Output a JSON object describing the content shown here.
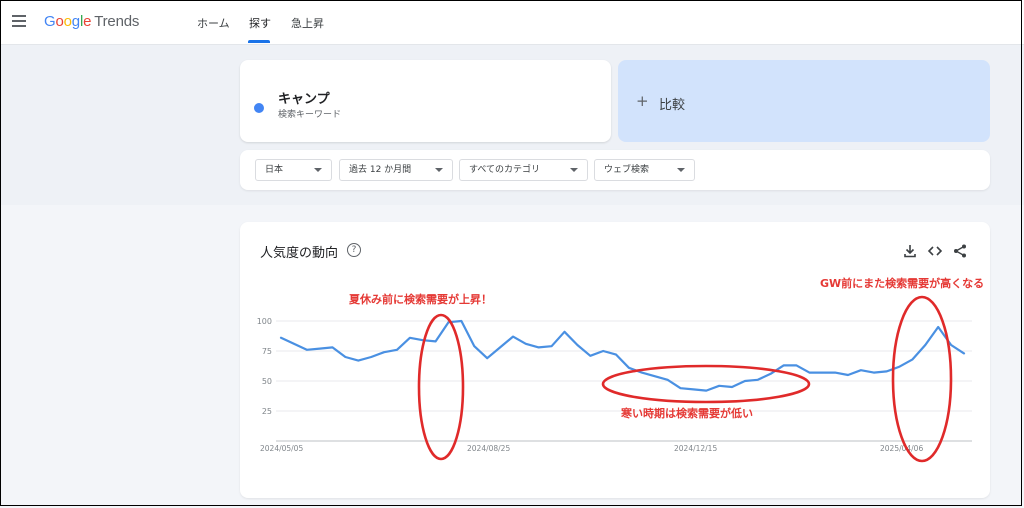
{
  "topbar": {
    "logo": {
      "g1": "G",
      "g2": "o",
      "g3": "o",
      "g4": "g",
      "g5": "l",
      "g6": "e",
      "trends": "Trends"
    },
    "tabs": [
      {
        "label": "ホーム"
      },
      {
        "label": "探す"
      },
      {
        "label": "急上昇"
      }
    ]
  },
  "search_term": {
    "name": "キャンプ",
    "subtitle": "検索キーワード",
    "color": "#4285f4"
  },
  "compare": {
    "plus": "+",
    "label": "比較"
  },
  "filters": [
    {
      "label": "日本"
    },
    {
      "label": "過去 12 か月間"
    },
    {
      "label": "すべてのカテゴリ"
    },
    {
      "label": "ウェブ検索"
    }
  ],
  "chart_card": {
    "title": "人気度の動向",
    "help": "?",
    "icons": [
      "download-icon",
      "embed-icon",
      "share-icon"
    ]
  },
  "chart_data": {
    "type": "line",
    "series": [
      {
        "values": [
          86,
          81,
          76,
          77,
          78,
          70,
          67,
          70,
          74,
          76,
          86,
          84,
          83,
          99,
          100,
          79,
          69,
          78,
          87,
          81,
          78,
          79,
          91,
          80,
          71,
          75,
          72,
          61,
          57,
          54,
          51,
          44,
          43,
          42,
          46,
          45,
          50,
          51,
          56,
          63,
          63,
          57,
          57,
          57,
          55,
          59,
          57,
          58,
          62,
          68,
          80,
          95,
          80,
          73
        ]
      }
    ],
    "y_ticks": [
      "100",
      "75",
      "50",
      "25"
    ],
    "x_ticks": [
      "2024/05/05",
      "2024/08/25",
      "2024/12/15",
      "2025/04/06"
    ],
    "ylim": [
      0,
      100
    ],
    "color": "#4a90e2"
  },
  "annotations": [
    {
      "text": "夏休み前に検索需要が上昇！"
    },
    {
      "text": "寒い時期は検索需要が低い"
    },
    {
      "text": "GW前にまた検索需要が高くなる"
    }
  ],
  "annotation_color": "#e53935"
}
